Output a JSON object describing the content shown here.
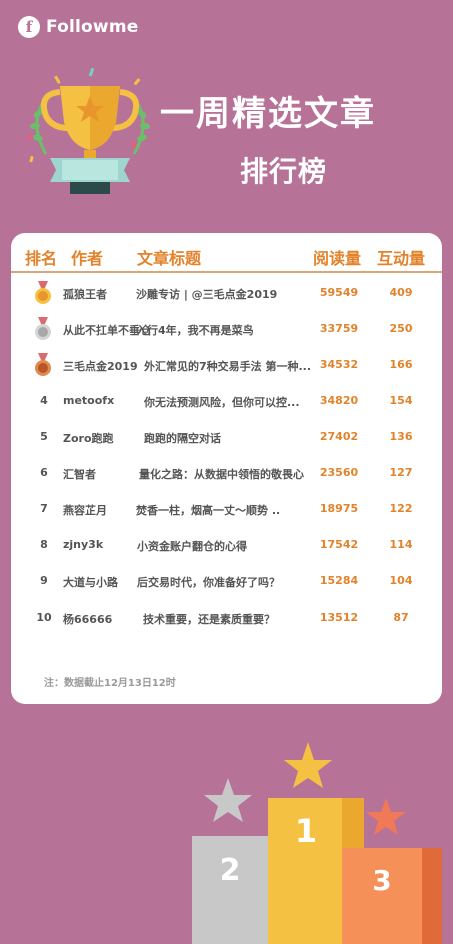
{
  "brand": {
    "logo_glyph": "f",
    "name": "Followme"
  },
  "header": {
    "title": "一周精选文章",
    "subtitle": "排行榜"
  },
  "table": {
    "columns": {
      "rank": "排名",
      "author": "作者",
      "title": "文章标题",
      "reads": "阅读量",
      "interactions": "互动量"
    },
    "rows": [
      {
        "rank": "",
        "medal": "gold",
        "author": "孤狼王者",
        "title": "沙雕专访 | @三毛点金2019",
        "reads": "59549",
        "interactions": "409"
      },
      {
        "rank": "",
        "medal": "silver",
        "author": "从此不扛单不垂仓",
        "title": "入行4年，我不再是菜鸟",
        "reads": "33759",
        "interactions": "250"
      },
      {
        "rank": "",
        "medal": "bronze",
        "author": "三毛点金2019",
        "title": "外汇常见的7种交易手法 第一种...",
        "reads": "34532",
        "interactions": "166"
      },
      {
        "rank": "4",
        "medal": "",
        "author": "metoofx",
        "title": "你无法预测风险，但你可以控...",
        "reads": "34820",
        "interactions": "154"
      },
      {
        "rank": "5",
        "medal": "",
        "author": "Zoro跑跑",
        "title": "跑跑的隔空对话",
        "reads": "27402",
        "interactions": "136"
      },
      {
        "rank": "6",
        "medal": "",
        "author": "汇智者",
        "title": "量化之路：从数据中领悟的敬畏心",
        "reads": "23560",
        "interactions": "127"
      },
      {
        "rank": "7",
        "medal": "",
        "author": "燕容芷月",
        "title": "焚香一柱，烟高一丈～顺势 ..",
        "reads": "18975",
        "interactions": "122"
      },
      {
        "rank": "8",
        "medal": "",
        "author": "zjny3k",
        "title": "小资金账户翻仓的心得",
        "reads": "17542",
        "interactions": "114"
      },
      {
        "rank": "9",
        "medal": "",
        "author": "大道与小路",
        "title": "后交易时代，你准备好了吗？",
        "reads": "15284",
        "interactions": "104"
      },
      {
        "rank": "10",
        "medal": "",
        "author": "杨66666",
        "title": "技术重要，还是素质重要？",
        "reads": "13512",
        "interactions": "87"
      }
    ],
    "note": "注：数据截止12月13日12时"
  },
  "podium": {
    "first": "1",
    "second": "2",
    "third": "3"
  },
  "colors": {
    "background": "#b77298",
    "accent": "#e2832b",
    "gold": "#f5c143",
    "silver": "#c8c8c8",
    "bronze": "#d7703a"
  }
}
